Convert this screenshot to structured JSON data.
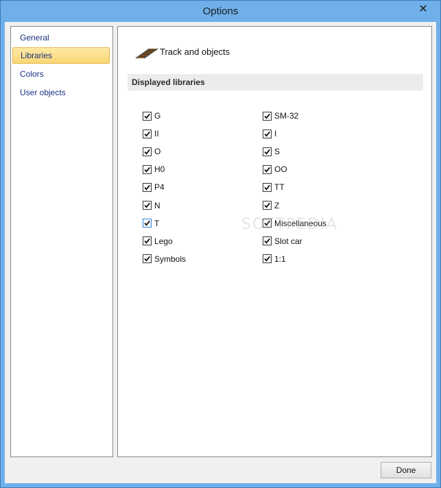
{
  "window": {
    "title": "Options"
  },
  "sidebar": {
    "items": [
      {
        "label": "General",
        "selected": false
      },
      {
        "label": "Libraries",
        "selected": true
      },
      {
        "label": "Colors",
        "selected": false
      },
      {
        "label": "User objects",
        "selected": false
      }
    ]
  },
  "content": {
    "header_icon": "track-icon",
    "header_title": "Track and objects",
    "section_title": "Displayed libraries",
    "left_column": [
      {
        "label": "G",
        "checked": true
      },
      {
        "label": "II",
        "checked": true
      },
      {
        "label": "O",
        "checked": true
      },
      {
        "label": "H0",
        "checked": true
      },
      {
        "label": "P4",
        "checked": true
      },
      {
        "label": "N",
        "checked": true
      },
      {
        "label": "T",
        "checked": true
      },
      {
        "label": "Lego",
        "checked": true
      },
      {
        "label": "Symbols",
        "checked": true
      }
    ],
    "right_column": [
      {
        "label": "SM-32",
        "checked": true
      },
      {
        "label": "I",
        "checked": true
      },
      {
        "label": "S",
        "checked": true
      },
      {
        "label": "OO",
        "checked": true
      },
      {
        "label": "TT",
        "checked": true
      },
      {
        "label": "Z",
        "checked": true
      },
      {
        "label": "Miscellaneous",
        "checked": true
      },
      {
        "label": "Slot car",
        "checked": true
      },
      {
        "label": "1:1",
        "checked": true
      }
    ]
  },
  "footer": {
    "done_label": "Done"
  },
  "colors": {
    "titlebar": "#6fb0ea",
    "selected_item_bg": "#f9d774",
    "nav_text": "#1a2f80"
  }
}
